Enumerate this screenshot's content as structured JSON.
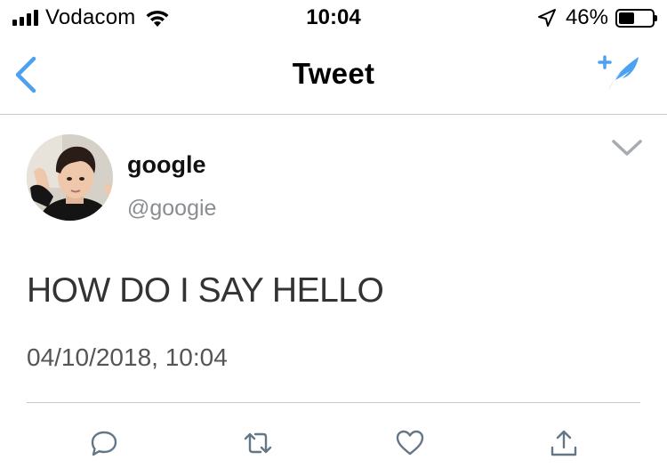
{
  "status_bar": {
    "carrier": "Vodacom",
    "time": "10:04",
    "battery_percent": "46%",
    "battery_level": 0.46,
    "signal_icon": "cellular-signal-icon",
    "wifi_icon": "wifi-icon",
    "location_icon": "location-arrow-icon",
    "battery_icon": "battery-icon"
  },
  "nav": {
    "title": "Tweet",
    "back_icon": "chevron-left-icon",
    "compose_icon": "compose-tweet-icon",
    "accent_color": "#4da1f1"
  },
  "tweet": {
    "display_name": "google",
    "handle": "@googie",
    "text": "HOW DO I SAY HELLO",
    "timestamp": "04/10/2018, 10:04",
    "more_icon": "chevron-down-icon"
  },
  "actions": [
    {
      "name": "reply",
      "icon": "reply-icon"
    },
    {
      "name": "retweet",
      "icon": "retweet-icon"
    },
    {
      "name": "like",
      "icon": "heart-icon"
    },
    {
      "name": "share",
      "icon": "share-icon"
    }
  ]
}
